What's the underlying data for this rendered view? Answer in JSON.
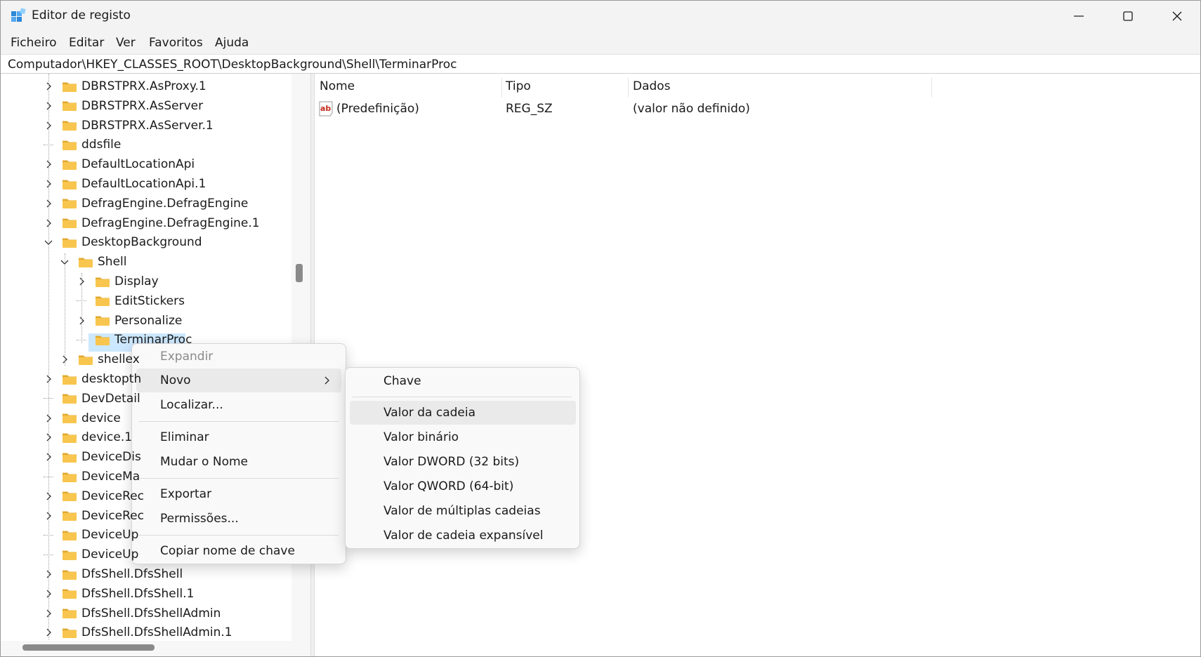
{
  "window": {
    "title": "Editor de registo",
    "controls": {
      "minimize_icon": "minimize-icon",
      "maximize_icon": "maximize-icon",
      "close_icon": "close-icon"
    }
  },
  "menu": [
    "Ficheiro",
    "Editar",
    "Ver",
    "Favoritos",
    "Ajuda"
  ],
  "address": "Computador\\HKEY_CLASSES_ROOT\\DesktopBackground\\Shell\\TerminarProc",
  "tree": [
    {
      "label": "DBRSTPRX.AsProxy.1",
      "expand": "collapsed"
    },
    {
      "label": "DBRSTPRX.AsServer",
      "expand": "collapsed"
    },
    {
      "label": "DBRSTPRX.AsServer.1",
      "expand": "collapsed"
    },
    {
      "label": "ddsfile",
      "expand": "none"
    },
    {
      "label": "DefaultLocationApi",
      "expand": "collapsed"
    },
    {
      "label": "DefaultLocationApi.1",
      "expand": "collapsed"
    },
    {
      "label": "DefragEngine.DefragEngine",
      "expand": "collapsed"
    },
    {
      "label": "DefragEngine.DefragEngine.1",
      "expand": "collapsed"
    },
    {
      "label": "DesktopBackground",
      "expand": "expanded"
    },
    {
      "label": "Shell",
      "expand": "expanded"
    },
    {
      "label": "Display",
      "expand": "collapsed"
    },
    {
      "label": "EditStickers",
      "expand": "none"
    },
    {
      "label": "Personalize",
      "expand": "collapsed"
    },
    {
      "label": "TerminarProc",
      "expand": "none",
      "selected": true
    },
    {
      "label": "shellex",
      "expand": "collapsed"
    },
    {
      "label": "desktopth",
      "expand": "collapsed"
    },
    {
      "label": "DevDetail",
      "expand": "none"
    },
    {
      "label": "device",
      "expand": "collapsed"
    },
    {
      "label": "device.1",
      "expand": "collapsed"
    },
    {
      "label": "DeviceDis",
      "expand": "collapsed"
    },
    {
      "label": "DeviceMa",
      "expand": "none"
    },
    {
      "label": "DeviceRec",
      "expand": "collapsed"
    },
    {
      "label": "DeviceRec",
      "expand": "collapsed"
    },
    {
      "label": "DeviceUp",
      "expand": "none"
    },
    {
      "label": "DeviceUp",
      "expand": "none"
    },
    {
      "label": "DfsShell.DfsShell",
      "expand": "collapsed"
    },
    {
      "label": "DfsShell.DfsShell.1",
      "expand": "collapsed"
    },
    {
      "label": "DfsShell.DfsShellAdmin",
      "expand": "collapsed"
    },
    {
      "label": "DfsShell.DfsShellAdmin.1",
      "expand": "collapsed"
    }
  ],
  "values": {
    "headers": [
      "Nome",
      "Tipo",
      "Dados"
    ],
    "rows": [
      {
        "name": "(Predefinição)",
        "type": "REG_SZ",
        "data": "(valor não definido)",
        "icon": "string-value-icon"
      }
    ]
  },
  "context_menu": {
    "items": [
      {
        "label": "Expandir",
        "disabled": true
      },
      {
        "label": "Novo",
        "submenu": true,
        "hover": true
      },
      {
        "label": "Localizar..."
      },
      {
        "separator": true
      },
      {
        "label": "Eliminar"
      },
      {
        "label": "Mudar o Nome"
      },
      {
        "separator": true
      },
      {
        "label": "Exportar"
      },
      {
        "label": "Permissões..."
      },
      {
        "separator": true
      },
      {
        "label": "Copiar nome de chave"
      }
    ]
  },
  "submenu": {
    "items": [
      {
        "label": "Chave"
      },
      {
        "separator": true
      },
      {
        "label": "Valor da cadeia",
        "hover": true
      },
      {
        "label": "Valor binário"
      },
      {
        "label": "Valor DWORD (32 bits)"
      },
      {
        "label": "Valor QWORD (64-bit)"
      },
      {
        "label": "Valor de múltiplas cadeias"
      },
      {
        "label": "Valor de cadeia expansível"
      }
    ]
  },
  "colors": {
    "selection": "#cce8ff",
    "folder": "#f8c64e",
    "chrome": "#f3f3f3"
  }
}
